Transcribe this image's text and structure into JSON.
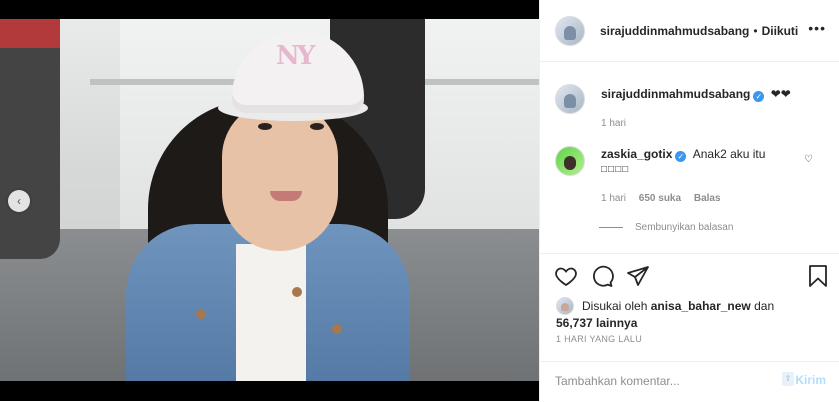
{
  "header": {
    "username": "sirajuddinmahmudsabang",
    "separator": "•",
    "follow_status": "Diikuti",
    "more_icon": "more-icon"
  },
  "caption": {
    "username": "sirajuddinmahmudsabang",
    "text": "❤❤",
    "time": "1 hari"
  },
  "comment": {
    "username": "zaskia_gotix",
    "text": "Anak2 aku itu",
    "emoji_placeholder": "□□□□",
    "time": "1 hari",
    "likes": "650 suka",
    "reply_label": "Balas",
    "hide_replies": "Sembunyikan balasan"
  },
  "likes": {
    "prefix": "Disukai oleh",
    "user": "anisa_bahar_new",
    "conj": "dan",
    "count": "56,737",
    "suffix": "lainnya"
  },
  "post_time": "1 HARI YANG LALU",
  "add_comment": {
    "placeholder": "Tambahkan komentar...",
    "post_label": "Kirim"
  },
  "photo": {
    "cap_text": "NY"
  },
  "nav": {
    "prev_glyph": "‹"
  }
}
